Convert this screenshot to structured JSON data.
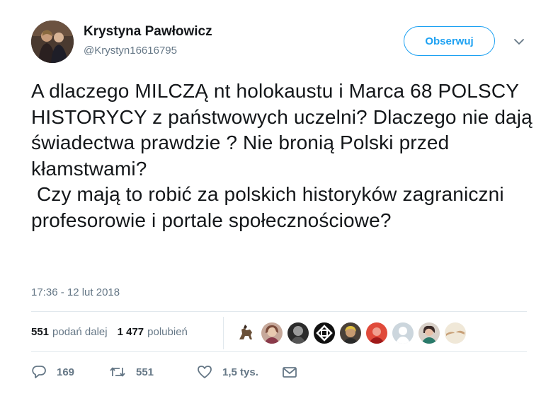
{
  "author": {
    "name": "Krystyna Pawłowicz",
    "handle": "@Krystyn16616795"
  },
  "follow_button_label": "Obserwuj",
  "tweet": {
    "text": "A dlaczego MILCZĄ nt holokaustu i Marca 68 POLSCY HISTORYCY z państwowych uczelni? Dlaczego nie dają świadectwa prawdzie ? Nie bronią Polski przed kłamstwami?\n Czy mają to robić za polskich historyków zagraniczni profesorowie i portale społecznościowe?",
    "timestamp": "17:36 - 12 lut 2018"
  },
  "stats": {
    "retweets_count": "551",
    "retweets_label": "podań dalej",
    "likes_count": "1 477",
    "likes_label": "polubień"
  },
  "liker_avatars": [
    {
      "icon": "horse-rider-avatar",
      "color": "#8a6a4a"
    },
    {
      "icon": "portrait-avatar",
      "color": "#b89a8a"
    },
    {
      "icon": "portrait-avatar",
      "color": "#2b2b2b"
    },
    {
      "icon": "geometric-logo-avatar",
      "color": "#111111"
    },
    {
      "icon": "portrait-avatar",
      "color": "#6b5a4a"
    },
    {
      "icon": "red-portrait-avatar",
      "color": "#d0342c"
    },
    {
      "icon": "default-profile-avatar",
      "color": "#ccd6dd"
    },
    {
      "icon": "portrait-avatar",
      "color": "#7a5a6a"
    },
    {
      "icon": "hands-art-avatar",
      "color": "#e8dcc8"
    }
  ],
  "actions": {
    "reply_count": "169",
    "retweet_count": "551",
    "like_count": "1,5 tys."
  },
  "colors": {
    "accent": "#1da1f2",
    "text_primary": "#14171a",
    "text_secondary": "#657786",
    "divider": "#e1e8ed"
  }
}
